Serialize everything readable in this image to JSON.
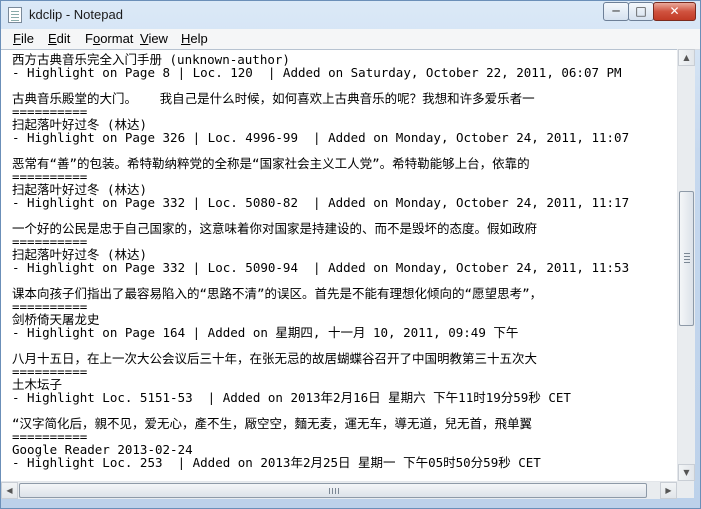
{
  "window": {
    "title": "kdclip - Notepad",
    "controls": {
      "minimize": "─",
      "maximize": "□",
      "close": "✕"
    }
  },
  "menu": [
    {
      "acc": "F",
      "rest": "ile"
    },
    {
      "acc": "E",
      "rest": "dit"
    },
    {
      "acc": "",
      "rest": "F",
      "rest2": "ormat",
      "accMid": "o"
    },
    {
      "acc": "V",
      "rest": "iew"
    },
    {
      "acc": "H",
      "rest": "elp"
    }
  ],
  "document": {
    "lines": [
      "西方古典音乐完全入门手册 (unknown-author)",
      "- Highlight on Page 8 | Loc. 120  | Added on Saturday, October 22, 2011, 06:07 PM",
      "",
      "古典音乐殿堂的大门。   我自己是什么时候，如何喜欢上古典音乐的呢？我想和许多爱乐者一",
      "==========",
      "扫起落叶好过冬 (林达)",
      "- Highlight on Page 326 | Loc. 4996-99  | Added on Monday, October 24, 2011, 11:07",
      "",
      "恶常有“善”的包装。希特勒纳粹党的全称是“国家社会主义工人党”。希特勒能够上台，依靠的",
      "==========",
      "扫起落叶好过冬 (林达)",
      "- Highlight on Page 332 | Loc. 5080-82  | Added on Monday, October 24, 2011, 11:17",
      "",
      "一个好的公民是忠于自己国家的，这意味着你对国家是持建设的、而不是毁坏的态度。假如政府",
      "==========",
      "扫起落叶好过冬 (林达)",
      "- Highlight on Page 332 | Loc. 5090-94  | Added on Monday, October 24, 2011, 11:53",
      "",
      "课本向孩子们指出了最容易陷入的“思路不清”的误区。首先是不能有理想化倾向的“愿望思考”，",
      "==========",
      "剑桥倚天屠龙史",
      "- Highlight on Page 164 | Added on 星期四, 十一月 10, 2011, 09:49 下午",
      "",
      "八月十五日，在上一次大公会议后三十年，在张无忌的故居蝴蝶谷召开了中国明教第三十五次大",
      "==========",
      "土木坛子",
      "- Highlight Loc. 5151-53  | Added on 2013年2月16日 星期六 下午11时19分59秒 CET",
      "",
      "“汉字简化后，親不见，爱无心，產不生，厰空空，麵无麦，運无车，導无道，兒无首，飛单翼",
      "==========",
      "Google Reader 2013-02-24",
      "- Highlight Loc. 253  | Added on 2013年2月25日 星期一 下午05时50分59秒 CET"
    ]
  },
  "scrollbars": {
    "vertical": {
      "position": 0.45
    },
    "horizontal": {
      "position": 0.0
    }
  }
}
